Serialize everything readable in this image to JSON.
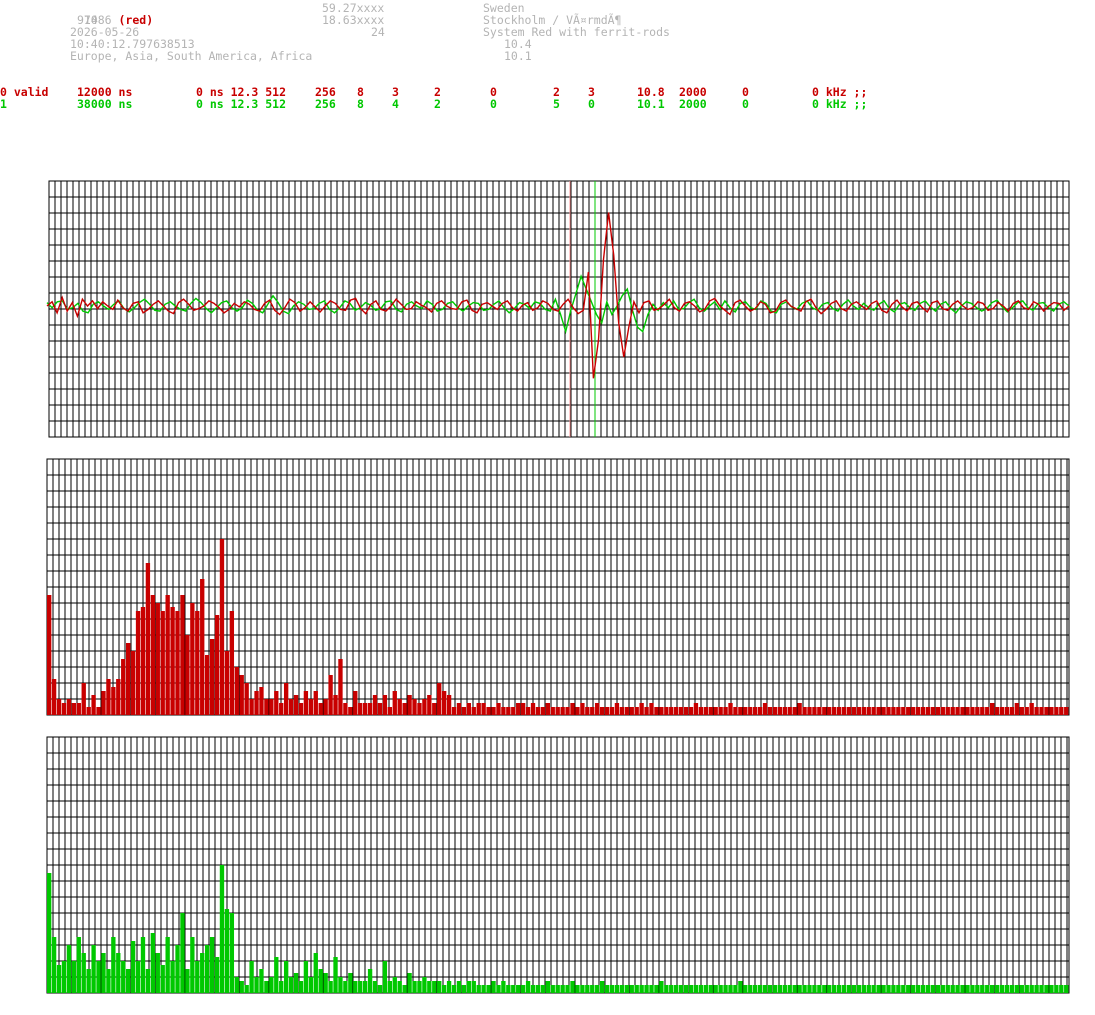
{
  "header": {
    "station_id": "1086",
    "station_color": "(red)",
    "line2": "974",
    "date": "2026-05-26",
    "time": "10:40:12.797638513",
    "regions": "Europe, Asia, South America, Africa",
    "lat": "59.27xxxx",
    "lon": "18.63xxxx",
    "num": "24",
    "country": "Sweden",
    "city": "Stockholm / VÃ¤rmdÃ¶",
    "system": "System Red with ferrit-rods",
    "val1": "10.4",
    "val2": "10.1"
  },
  "rows": [
    {
      "c0": "0 valid",
      "c1": "12000 ns",
      "c2": "0 ns 12.3 512",
      "c3": "256",
      "c4": "8",
      "c5": "3",
      "c6": "2",
      "c7": "0",
      "c8": "2",
      "c9": "3",
      "c10": "10.8",
      "c11": "2000",
      "c12": "0",
      "c13": "0 kHz ;;"
    },
    {
      "c0": "1",
      "c1": "38000 ns",
      "c2": "0 ns 12.3 512",
      "c3": "256",
      "c4": "8",
      "c5": "4",
      "c6": "2",
      "c7": "0",
      "c8": "5",
      "c9": "0",
      "c10": "10.1",
      "c11": "2000",
      "c12": "0",
      "c13": "0 kHz ;;"
    }
  ],
  "colors": {
    "red": "#c80000",
    "green": "#00c800",
    "grid": "#000000",
    "label": "#b4b4b4"
  },
  "chart_data": [
    {
      "type": "line",
      "series": [
        {
          "color": "#c80000",
          "values": [
            0,
            5,
            -8,
            10,
            -6,
            4,
            -12,
            8,
            0,
            6,
            -3,
            5,
            0,
            -4,
            7,
            -2,
            -6,
            3,
            5,
            -8,
            -4,
            2,
            6,
            0,
            -6,
            -9,
            4,
            8,
            2,
            -5,
            -3,
            0,
            6,
            3,
            -2,
            -8,
            -4,
            3,
            -1,
            5,
            2,
            -4,
            -6,
            3,
            7,
            -5,
            -10,
            -2,
            8,
            4,
            -6,
            -2,
            5,
            -1,
            -7,
            0,
            6,
            3,
            -4,
            -5,
            7,
            9,
            -3,
            -9,
            2,
            6,
            -4,
            -6,
            0,
            8,
            2,
            -4,
            -3,
            5,
            1,
            -2,
            -7,
            3,
            6,
            0,
            -3,
            -4,
            5,
            7,
            -5,
            -8,
            2,
            4,
            0,
            -4,
            3,
            6,
            -2,
            -6,
            1,
            4,
            -5,
            -2,
            6,
            3,
            -4,
            -6,
            2,
            8,
            -2,
            -9,
            -5,
            40,
            -85,
            -40,
            55,
            110,
            60,
            -20,
            -60,
            -25,
            5,
            -8,
            4,
            6,
            -5,
            -3,
            2,
            8,
            -2,
            -6,
            3,
            5,
            0,
            -7,
            -4,
            6,
            9,
            0,
            -5,
            -10,
            4,
            7,
            0,
            -6,
            -3,
            5,
            2,
            -8,
            -6,
            4,
            7,
            0,
            -3,
            -6,
            5,
            8,
            -2,
            -9,
            -4,
            3,
            6,
            -3,
            -6,
            2,
            5,
            0,
            -4,
            3,
            6,
            -5,
            -8,
            2,
            7,
            -1,
            -6,
            3,
            5,
            -2,
            -7,
            4,
            6,
            -3,
            -5,
            2,
            6,
            0,
            -4,
            -2,
            5,
            3,
            -5,
            -3,
            4,
            0,
            -6,
            3,
            6,
            -2,
            -4,
            5,
            2,
            -6,
            0,
            4,
            3,
            -5,
            0
          ]
        },
        {
          "color": "#00c800",
          "values": [
            4,
            -2,
            5,
            6,
            -4,
            -2,
            3,
            -6,
            -8,
            2,
            5,
            0,
            -4,
            2,
            6,
            -3,
            -7,
            -2,
            4,
            8,
            2,
            -5,
            -6,
            2,
            5,
            0,
            -4,
            -6,
            3,
            9,
            4,
            -3,
            -8,
            -2,
            4,
            6,
            -2,
            -6,
            -2,
            7,
            3,
            -5,
            -8,
            2,
            12,
            4,
            -6,
            -9,
            0,
            5,
            2,
            -4,
            -3,
            3,
            6,
            -4,
            -8,
            -2,
            6,
            3,
            -5,
            -2,
            4,
            1,
            -5,
            -3,
            5,
            6,
            -4,
            -7,
            2,
            5,
            0,
            -3,
            6,
            2,
            -6,
            -4,
            3,
            5,
            -2,
            -6,
            0,
            4,
            3,
            -5,
            -4,
            2,
            6,
            -2,
            -8,
            -3,
            4,
            2,
            -3,
            5,
            3,
            -4,
            -6,
            8,
            -10,
            -30,
            -5,
            15,
            35,
            20,
            5,
            -10,
            -20,
            5,
            -10,
            0,
            12,
            20,
            -5,
            -25,
            -30,
            -10,
            2,
            -5,
            4,
            -2,
            6,
            -4,
            -3,
            4,
            8,
            -2,
            -6,
            0,
            5,
            -4,
            6,
            -2,
            -7,
            3,
            5,
            -2,
            -4,
            6,
            3,
            -6,
            -8,
            2,
            5,
            -1,
            -4,
            3,
            6,
            -2,
            -5,
            2,
            4,
            -3,
            -6,
            2,
            7,
            0,
            -4,
            3,
            -2,
            -5,
            2,
            6,
            -3,
            -7,
            2,
            4,
            -2,
            -5,
            3,
            6,
            -1,
            -6,
            2,
            5,
            -3,
            -8,
            0,
            5,
            3,
            -2,
            -6,
            -3,
            4,
            7,
            -1,
            -7,
            -2,
            4,
            6,
            -2,
            -5,
            3,
            4,
            -2,
            -6,
            2,
            5,
            0
          ]
        }
      ]
    },
    {
      "type": "bar",
      "color": "#c80000",
      "values": [
        30,
        9,
        4,
        3,
        4,
        3,
        3,
        8,
        2,
        5,
        2,
        6,
        9,
        7,
        9,
        14,
        18,
        16,
        26,
        27,
        38,
        30,
        28,
        26,
        30,
        27,
        26,
        30,
        20,
        28,
        26,
        34,
        15,
        19,
        25,
        44,
        16,
        26,
        12,
        10,
        8,
        4,
        6,
        7,
        4,
        4,
        6,
        3,
        8,
        4,
        5,
        3,
        6,
        4,
        6,
        3,
        4,
        10,
        5,
        14,
        3,
        2,
        6,
        3,
        3,
        3,
        5,
        3,
        5,
        2,
        6,
        4,
        3,
        5,
        4,
        3,
        4,
        5,
        3,
        8,
        6,
        5,
        2,
        3,
        2,
        3,
        2,
        3,
        3,
        2,
        2,
        3,
        2,
        2,
        2,
        3,
        3,
        2,
        3,
        2,
        2,
        3,
        2,
        2,
        2,
        2,
        3,
        2,
        3,
        2,
        2,
        3,
        2,
        2,
        2,
        3,
        2,
        2,
        2,
        2,
        3,
        2,
        3,
        2,
        2,
        2,
        2,
        2,
        2,
        2,
        2,
        3,
        2,
        2,
        2,
        2,
        2,
        2,
        3,
        2,
        2,
        2,
        2,
        2,
        2,
        3,
        2,
        2,
        2,
        2,
        2,
        2,
        3,
        2,
        2,
        2,
        2,
        2,
        2,
        2,
        2,
        2,
        2,
        2,
        2,
        2,
        2,
        2,
        2,
        2,
        2,
        2,
        2,
        2,
        2,
        2,
        2,
        2,
        2,
        2,
        2,
        2,
        2,
        2,
        2,
        2,
        2,
        2,
        2,
        2,
        2,
        3,
        2,
        2,
        2,
        2,
        3,
        2,
        2,
        3,
        2,
        2,
        2,
        2,
        2,
        2,
        2
      ]
    },
    {
      "type": "bar",
      "color": "#00c800",
      "values": [
        30,
        14,
        7,
        8,
        12,
        8,
        14,
        10,
        6,
        12,
        8,
        10,
        6,
        14,
        10,
        8,
        6,
        13,
        8,
        14,
        6,
        15,
        10,
        7,
        14,
        8,
        12,
        20,
        6,
        14,
        8,
        10,
        12,
        14,
        9,
        32,
        21,
        20,
        4,
        3,
        2,
        8,
        4,
        6,
        3,
        4,
        9,
        3,
        8,
        4,
        5,
        3,
        8,
        4,
        10,
        6,
        5,
        3,
        9,
        4,
        3,
        5,
        3,
        3,
        3,
        6,
        3,
        2,
        8,
        3,
        4,
        3,
        2,
        5,
        3,
        3,
        4,
        3,
        3,
        3,
        2,
        3,
        2,
        3,
        2,
        3,
        3,
        2,
        2,
        2,
        3,
        2,
        3,
        2,
        2,
        2,
        2,
        3,
        2,
        2,
        2,
        3,
        2,
        2,
        2,
        2,
        3,
        2,
        2,
        2,
        2,
        2,
        3,
        2,
        2,
        2,
        2,
        2,
        2,
        2,
        2,
        2,
        2,
        2,
        3,
        2,
        2,
        2,
        2,
        2,
        2,
        2,
        2,
        2,
        2,
        2,
        2,
        2,
        2,
        2,
        3,
        2,
        2,
        2,
        2,
        2,
        2,
        2,
        2,
        2,
        2,
        2,
        2,
        2,
        2,
        2,
        2,
        2,
        2,
        2,
        2,
        2,
        2,
        2,
        2,
        2,
        2,
        2,
        2,
        2,
        2,
        2,
        2,
        2,
        2,
        2,
        2,
        2,
        2,
        2,
        2,
        2,
        2,
        2,
        2,
        2,
        2,
        2,
        2,
        2,
        2,
        2,
        2,
        2,
        2,
        2,
        2,
        2,
        2,
        2,
        2,
        2,
        2,
        2,
        2,
        2,
        2
      ]
    }
  ]
}
